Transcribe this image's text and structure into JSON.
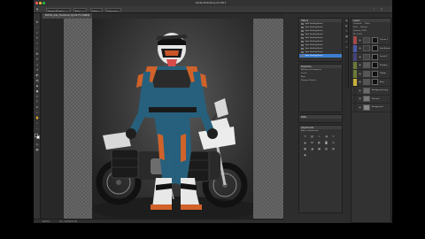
{
  "window": {
    "title": "Adobe Photoshop CC 2017",
    "traffic_colors": [
      "#fe5f57",
      "#febc2e",
      "#28c840"
    ]
  },
  "options_bar": {
    "items": [
      "Sample All Layers",
      "Auto-Enhance",
      "Refine Edge...",
      "Select and Mask..."
    ],
    "mode_value": "Normal"
  },
  "document": {
    "tab_label": "MOTO1_bike_Thumbnail_1@ 66.7% (RGB/8)"
  },
  "status": {
    "zoom": "66.67%",
    "doc_info": "Doc: 6.95M/47.2M"
  },
  "panels": {
    "history": {
      "title": "History",
      "rows": [
        "Spot Healing Brush",
        "Spot Healing Brush",
        "Spot Healing Brush",
        "Spot Healing Brush",
        "Spot Healing Brush",
        "Spot Healing Brush",
        "Spot Healing Brush",
        "Spot Healing Brush",
        "Spot Healing Brush",
        "Spot Healing Brush"
      ],
      "selected_index": 9
    },
    "properties": {
      "title": "Properties",
      "rows": [
        "Adjustment Properties",
        "Levels",
        "Auto",
        "Sharpen Details"
      ]
    },
    "paths": {
      "title": "Paths"
    },
    "adjustments": {
      "title": "Adjustments",
      "subtitle": "Add an adjustment",
      "icons": [
        "sun",
        "levels",
        "curves",
        "exposure",
        "vibrance",
        "hue",
        "balance",
        "bw",
        "photo",
        "mixer",
        "lookup",
        "invert",
        "posterize",
        "threshold",
        "gradient",
        "selective"
      ]
    },
    "layers": {
      "title": "Layers",
      "tabs": [
        "Channels",
        "Paths"
      ],
      "kind": "Kind",
      "blend": "Normal",
      "opacity": "Opacity: 100%",
      "fill": "Fill: 100%",
      "rows": [
        {
          "name": "Curves 1",
          "color": "#a44848",
          "thumb": "#444"
        },
        {
          "name": "Hue/Saturation",
          "color": "#4a5aa6",
          "thumb": "#3b3b3b"
        },
        {
          "name": "Levels 1",
          "color": "#44447a",
          "thumb": "#444"
        },
        {
          "name": "Sharpen",
          "color": "#6b7a36",
          "thumb": "#5a5a5a"
        },
        {
          "name": "Dodge",
          "color": "#6b7a36",
          "thumb": "#555"
        },
        {
          "name": "Burn",
          "color": "#c9b23a",
          "thumb": "#555"
        },
        {
          "name": "Background copy",
          "color": "#2d2d2d",
          "thumb": "#6a6a6a"
        },
        {
          "name": "Retouch",
          "color": "#2d2d2d",
          "thumb": "#777"
        },
        {
          "name": "Background",
          "color": "#2d2d2d",
          "thumb": "#888"
        }
      ]
    }
  },
  "colors": {
    "foreground": "#000000",
    "background": "#ffffff",
    "rider_blue": "#27607c",
    "rider_orange": "#d0622a"
  }
}
